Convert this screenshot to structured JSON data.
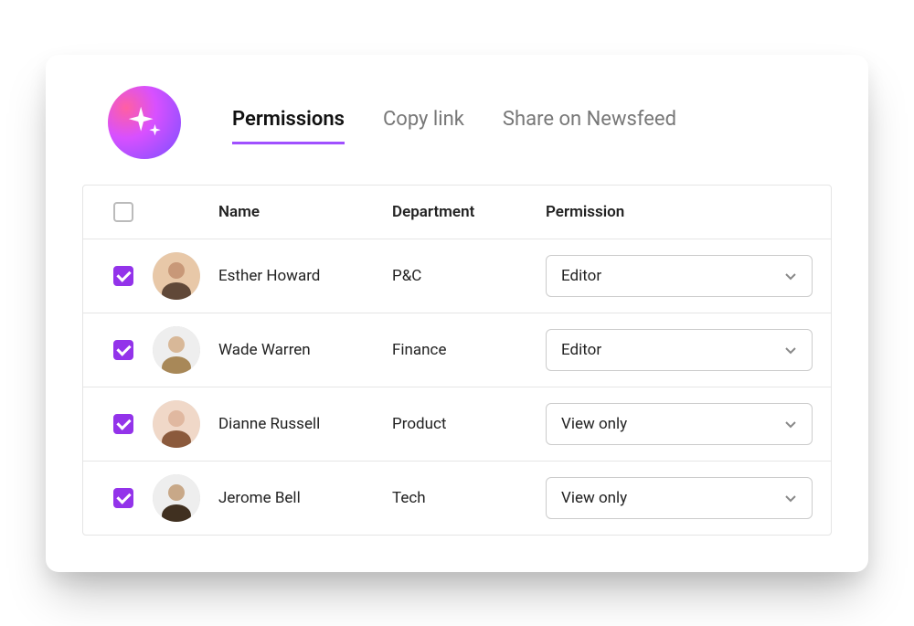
{
  "tabs": [
    {
      "label": "Permissions",
      "active": true
    },
    {
      "label": "Copy link",
      "active": false
    },
    {
      "label": "Share on Newsfeed",
      "active": false
    }
  ],
  "columns": {
    "name": "Name",
    "department": "Department",
    "permission": "Permission"
  },
  "rows": [
    {
      "name": "Esther Howard",
      "department": "P&C",
      "permission": "Editor",
      "checked": true
    },
    {
      "name": "Wade Warren",
      "department": "Finance",
      "permission": "Editor",
      "checked": true
    },
    {
      "name": "Dianne Russell",
      "department": "Product",
      "permission": "View only",
      "checked": true
    },
    {
      "name": "Jerome Bell",
      "department": "Tech",
      "permission": "View only",
      "checked": true
    }
  ],
  "colors": {
    "accent": "#9333ea"
  }
}
